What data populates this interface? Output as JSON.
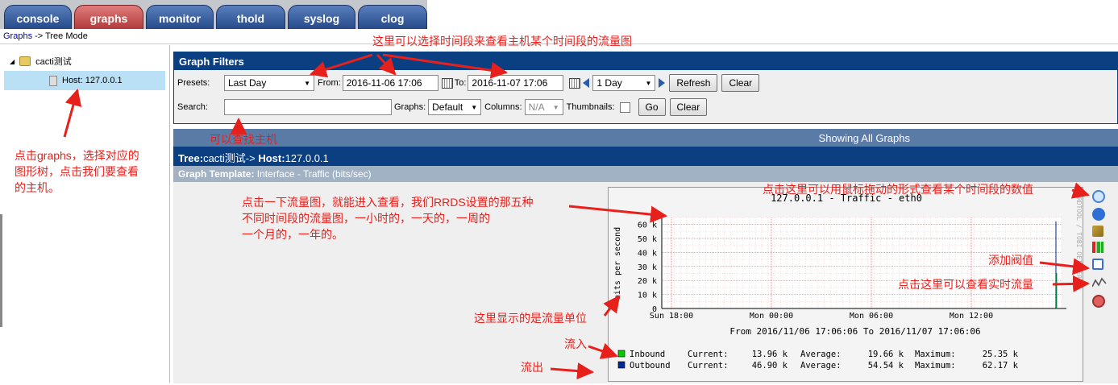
{
  "tabs": [
    "console",
    "graphs",
    "monitor",
    "thold",
    "syslog",
    "clog"
  ],
  "breadcrumb": {
    "link": "Graphs",
    "rest": "-> Tree Mode"
  },
  "tree": {
    "root": "cacti测试",
    "host": "Host: 127.0.0.1"
  },
  "filters": {
    "title": "Graph Filters",
    "presets_label": "Presets:",
    "presets_value": "Last Day",
    "from_label": "From:",
    "from_value": "2016-11-06 17:06",
    "to_label": "To:",
    "to_value": "2016-11-07 17:06",
    "span_value": "1 Day",
    "refresh": "Refresh",
    "clear": "Clear",
    "search_label": "Search:",
    "graphs_label": "Graphs:",
    "graphs_value": "Default",
    "columns_label": "Columns:",
    "columns_value": "N/A",
    "thumbs_label": "Thumbnails:",
    "go": "Go",
    "clear2": "Clear"
  },
  "showing": "Showing All Graphs",
  "tree_header": {
    "tree_label": "Tree:",
    "tree_value": "cacti测试-> ",
    "host_label": "Host:",
    "host_value": "127.0.0.1"
  },
  "template_header": {
    "label": "Graph Template:",
    "value": " Interface - Traffic (bits/sec)"
  },
  "chart_data": {
    "type": "line",
    "title": "127.0.0.1 - Traffic - eth0",
    "ylabel": "bits per second",
    "side_label": "RRDTOOL / TOBI OETIKER",
    "yticks": [
      "0",
      "10 k",
      "20 k",
      "30 k",
      "40 k",
      "50 k",
      "60 k"
    ],
    "ylim": [
      0,
      65
    ],
    "xticks": [
      "Sun 18:00",
      "Mon 00:00",
      "Mon 06:00",
      "Mon 12:00"
    ],
    "xlabel": "From 2016/11/06 17:06:06 To 2016/11/07 17:06:06",
    "grid": true,
    "series": [
      {
        "name": "Inbound",
        "color": "#00cc00",
        "current": "13.96 k",
        "average": "19.66 k",
        "maximum": "25.35 k"
      },
      {
        "name": "Outbound",
        "color": "#002a97",
        "current": "46.90 k",
        "average": "54.54 k",
        "maximum": "62.17 k"
      }
    ],
    "current_label": "Current:",
    "average_label": "Average:",
    "maximum_label": "Maximum:"
  },
  "annotations": {
    "time": "这里可以选择时间段来查看主机某个时间段的流量图",
    "search": "可以查找主机",
    "tree_1": "点击graphs，选择对应的",
    "tree_2": "图形树，点击我们要查看",
    "tree_3": "的主机。",
    "graph_1": "点击一下流量图，就能进入查看，我们RRDS设置的那五种",
    "graph_2": "不同时间段的流量图，一小时的，一天的，一周的",
    "graph_3": "一个月的，一年的。",
    "zoom": "点击这里可以用鼠标拖动的形式查看某个时间段的数值",
    "thold": "添加阀值",
    "realtime": "点击这里可以查看实时流量",
    "unit": "这里显示的是流量单位",
    "in": "流入",
    "out": "流出"
  },
  "colors": {
    "header_blue": "#0a3f82",
    "annotation_red": "#e8201c"
  }
}
